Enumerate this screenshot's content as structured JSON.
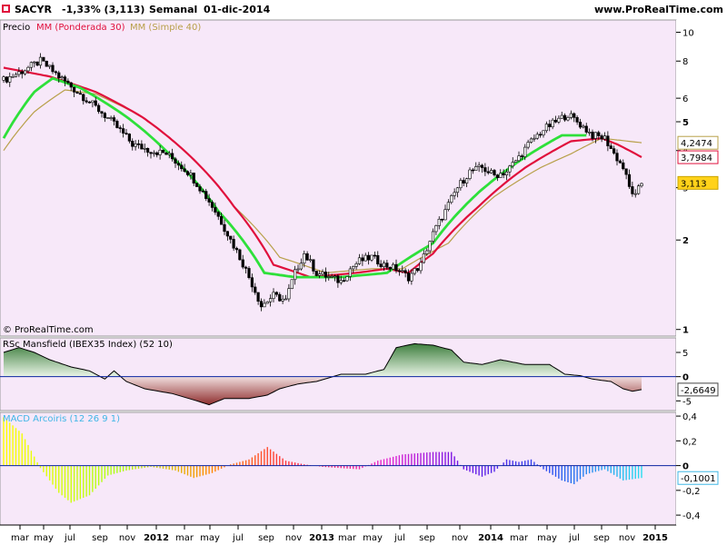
{
  "header": {
    "ticker": "SACYR",
    "change": "-1,33% (3,113)",
    "period": "Semanal",
    "date": "01-dic-2014",
    "site": "www.ProRealTime.com"
  },
  "copyright": "© ProRealTime.com",
  "colors": {
    "background": "#f7e8f9",
    "candle_up": "#ffffff",
    "candle_down": "#000000",
    "wma": "#e0103c",
    "sma": "#b8a04a",
    "green_ma": "#2ee03a",
    "rsc_pos_fill": "#5c9a5c",
    "rsc_neg_fill": "#a23a3a",
    "zero_line": "#0b24a0"
  },
  "chart_data": [
    {
      "type": "candlestick",
      "panel": "price",
      "legend": [
        "Precio",
        "MM (Ponderada 30)",
        "MM (Simple 40)"
      ],
      "yscale": "log",
      "ylim": [
        0.95,
        11
      ],
      "y_ticks": [
        "10",
        "8",
        "6",
        "5",
        "4",
        "3",
        "2",
        "1"
      ],
      "x_ticks": [
        "mar",
        "may",
        "jul",
        "sep",
        "nov",
        "2012",
        "mar",
        "may",
        "jul",
        "sep",
        "nov",
        "2013",
        "mar",
        "may",
        "jul",
        "sep",
        "nov",
        "2014",
        "mar",
        "may",
        "jul",
        "sep",
        "nov",
        "2015"
      ],
      "close_path": [
        [
          0,
          6.9
        ],
        [
          6,
          7.4
        ],
        [
          12,
          8.0
        ],
        [
          18,
          7.1
        ],
        [
          24,
          6.3
        ],
        [
          30,
          5.6
        ],
        [
          36,
          4.9
        ],
        [
          42,
          4.2
        ],
        [
          48,
          4.0
        ],
        [
          53,
          3.9
        ],
        [
          60,
          3.4
        ],
        [
          68,
          2.6
        ],
        [
          74,
          2.0
        ],
        [
          80,
          1.5
        ],
        [
          84,
          1.2
        ],
        [
          88,
          1.3
        ],
        [
          92,
          1.25
        ],
        [
          95,
          1.55
        ],
        [
          98,
          1.8
        ],
        [
          102,
          1.55
        ],
        [
          106,
          1.5
        ],
        [
          110,
          1.45
        ],
        [
          113,
          1.6
        ],
        [
          116,
          1.7
        ],
        [
          120,
          1.75
        ],
        [
          124,
          1.65
        ],
        [
          128,
          1.6
        ],
        [
          132,
          1.5
        ],
        [
          136,
          1.65
        ],
        [
          140,
          2.1
        ],
        [
          144,
          2.5
        ],
        [
          148,
          3.0
        ],
        [
          152,
          3.4
        ],
        [
          156,
          3.5
        ],
        [
          160,
          3.3
        ],
        [
          164,
          3.4
        ],
        [
          168,
          3.8
        ],
        [
          172,
          4.3
        ],
        [
          176,
          4.7
        ],
        [
          180,
          5.0
        ],
        [
          184,
          5.3
        ],
        [
          188,
          4.9
        ],
        [
          192,
          4.5
        ],
        [
          196,
          4.4
        ],
        [
          199,
          3.9
        ],
        [
          202,
          3.5
        ],
        [
          204,
          3.0
        ],
        [
          206,
          2.8
        ],
        [
          208,
          3.113
        ]
      ],
      "series": [
        {
          "name": "MM (Ponderada 30)",
          "last": "3,7984",
          "path": [
            [
              0,
              7.6
            ],
            [
              15,
              7.1
            ],
            [
              30,
              6.3
            ],
            [
              45,
              5.2
            ],
            [
              60,
              3.9
            ],
            [
              75,
              2.6
            ],
            [
              88,
              1.65
            ],
            [
              100,
              1.5
            ],
            [
              115,
              1.55
            ],
            [
              125,
              1.6
            ],
            [
              132,
              1.55
            ],
            [
              140,
              1.8
            ],
            [
              155,
              2.6
            ],
            [
              170,
              3.5
            ],
            [
              185,
              4.3
            ],
            [
              195,
              4.4
            ],
            [
              200,
              4.2
            ],
            [
              208,
              3.8
            ]
          ]
        },
        {
          "name": "MM (Simple 40)",
          "last": "4,2474",
          "path": [
            [
              0,
              4.0
            ],
            [
              10,
              5.4
            ],
            [
              20,
              6.4
            ],
            [
              30,
              6.2
            ],
            [
              45,
              5.2
            ],
            [
              60,
              3.9
            ],
            [
              75,
              2.6
            ],
            [
              90,
              1.75
            ],
            [
              105,
              1.55
            ],
            [
              120,
              1.6
            ],
            [
              130,
              1.6
            ],
            [
              145,
              1.95
            ],
            [
              160,
              2.8
            ],
            [
              175,
              3.5
            ],
            [
              185,
              3.9
            ],
            [
              195,
              4.4
            ],
            [
              208,
              4.25
            ]
          ]
        },
        {
          "name": "",
          "last": "3,113",
          "path": [
            [
              0,
              4.4
            ],
            [
              10,
              6.3
            ],
            [
              16,
              7.0
            ],
            [
              25,
              6.5
            ],
            [
              40,
              5.2
            ],
            [
              55,
              3.8
            ],
            [
              70,
              2.5
            ],
            [
              85,
              1.55
            ],
            [
              95,
              1.5
            ],
            [
              110,
              1.5
            ],
            [
              125,
              1.55
            ],
            [
              140,
              1.95
            ],
            [
              155,
              2.9
            ],
            [
              170,
              3.8
            ],
            [
              182,
              4.5
            ],
            [
              190,
              4.5
            ]
          ]
        }
      ]
    },
    {
      "type": "area",
      "panel": "rsc",
      "title": "RSc Mansfield (IBEX35 Index) (52 10)",
      "ylim": [
        -7,
        8
      ],
      "y_ticks": [
        "5",
        "0",
        "-5"
      ],
      "last": "-2,6649",
      "path": [
        [
          0,
          5
        ],
        [
          5,
          6
        ],
        [
          10,
          5
        ],
        [
          15,
          3.5
        ],
        [
          22,
          2
        ],
        [
          28,
          1.2
        ],
        [
          33,
          -0.5
        ],
        [
          36,
          1.2
        ],
        [
          40,
          -1
        ],
        [
          46,
          -2.5
        ],
        [
          55,
          -3.5
        ],
        [
          62,
          -4.8
        ],
        [
          67,
          -5.8
        ],
        [
          72,
          -4.5
        ],
        [
          80,
          -4.5
        ],
        [
          86,
          -3.8
        ],
        [
          90,
          -2.5
        ],
        [
          96,
          -1.5
        ],
        [
          102,
          -1
        ],
        [
          110,
          0.5
        ],
        [
          118,
          0.5
        ],
        [
          124,
          1.5
        ],
        [
          128,
          6
        ],
        [
          134,
          6.8
        ],
        [
          140,
          6.5
        ],
        [
          146,
          5.5
        ],
        [
          150,
          3
        ],
        [
          156,
          2.5
        ],
        [
          162,
          3.5
        ],
        [
          170,
          2.5
        ],
        [
          178,
          2.5
        ],
        [
          183,
          0.5
        ],
        [
          188,
          0.2
        ],
        [
          192,
          -0.5
        ],
        [
          198,
          -1
        ],
        [
          202,
          -2.5
        ],
        [
          205,
          -3
        ],
        [
          208,
          -2.66
        ]
      ]
    },
    {
      "type": "bar",
      "panel": "macd",
      "title": "MACD Arcoiris (12 26 9 1)",
      "ylim": [
        -0.48,
        0.43
      ],
      "y_ticks": [
        "0,4",
        "0,2",
        "0",
        "-0,2",
        "-0,4"
      ],
      "last": "-0,1001",
      "path": [
        [
          0,
          0.39
        ],
        [
          6,
          0.26
        ],
        [
          12,
          -0.02
        ],
        [
          18,
          -0.22
        ],
        [
          22,
          -0.3
        ],
        [
          28,
          -0.24
        ],
        [
          34,
          -0.08
        ],
        [
          40,
          -0.04
        ],
        [
          48,
          -0.01
        ],
        [
          56,
          -0.04
        ],
        [
          62,
          -0.1
        ],
        [
          68,
          -0.06
        ],
        [
          74,
          0.01
        ],
        [
          80,
          0.05
        ],
        [
          86,
          0.15
        ],
        [
          92,
          0.04
        ],
        [
          98,
          0.01
        ],
        [
          104,
          -0.01
        ],
        [
          110,
          -0.02
        ],
        [
          116,
          -0.03
        ],
        [
          122,
          0.04
        ],
        [
          130,
          0.09
        ],
        [
          140,
          0.11
        ],
        [
          146,
          0.11
        ],
        [
          150,
          -0.03
        ],
        [
          156,
          -0.09
        ],
        [
          160,
          -0.05
        ],
        [
          164,
          0.05
        ],
        [
          168,
          0.03
        ],
        [
          172,
          0.05
        ],
        [
          176,
          -0.03
        ],
        [
          182,
          -0.12
        ],
        [
          186,
          -0.15
        ],
        [
          190,
          -0.07
        ],
        [
          196,
          -0.03
        ],
        [
          202,
          -0.12
        ],
        [
          208,
          -0.1
        ]
      ]
    }
  ]
}
